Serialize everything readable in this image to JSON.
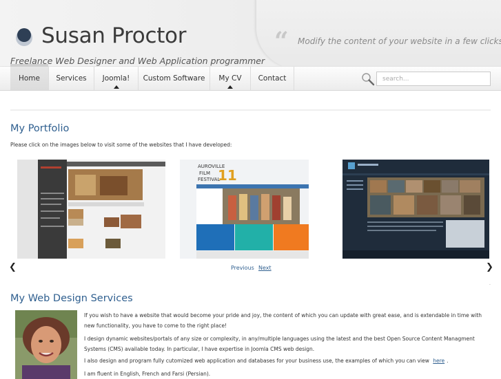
{
  "header": {
    "site_title": "Susan Proctor",
    "tagline": "Freelance Web Designer and Web Application programmer",
    "quote_mark": "“",
    "quote": "Modify the content of your website in a few clicks"
  },
  "nav": {
    "items": [
      {
        "label": "Home",
        "active": true,
        "has_submenu": false
      },
      {
        "label": "Services",
        "active": false,
        "has_submenu": false
      },
      {
        "label": "Joomla!",
        "active": false,
        "has_submenu": true
      },
      {
        "label": "Custom Software",
        "active": false,
        "has_submenu": false
      },
      {
        "label": "My CV",
        "active": false,
        "has_submenu": true
      },
      {
        "label": "Contact",
        "active": false,
        "has_submenu": false
      }
    ],
    "search_placeholder": "search..."
  },
  "portfolio": {
    "title": "My Portfolio",
    "intro": "Please click on the images below to visit some of the websites that I have developed:",
    "prev_arrow": "❮",
    "next_arrow": "❯",
    "pager_prev": "Previous",
    "pager_next": "Next",
    "tiny_marker": "."
  },
  "services": {
    "title": "My Web Design Services",
    "para1": "If you wish to have a website that would become your pride and joy, the content of which you can update with great ease, and is extendable in time with new functionality, you have to come to the right place!",
    "para2": "I design dynamic websites/portals of any size or complexity, in any/multiple languages using the latest and the best Open Source Content Managment Systems (CMS) available today. In particular, I have expertise in Joomla CMS web design.",
    "para3_before": "I also design and program fully cutomized web application and databases for your business use, the examples of which you can view",
    "para3_link": "here",
    "para3_after": ".",
    "para4": "I am fluent in English, French and Farsi (Persian)."
  },
  "colors": {
    "link": "#2f5f8f",
    "heading": "#2f5f8f",
    "logo_dark": "#2e3f55"
  }
}
